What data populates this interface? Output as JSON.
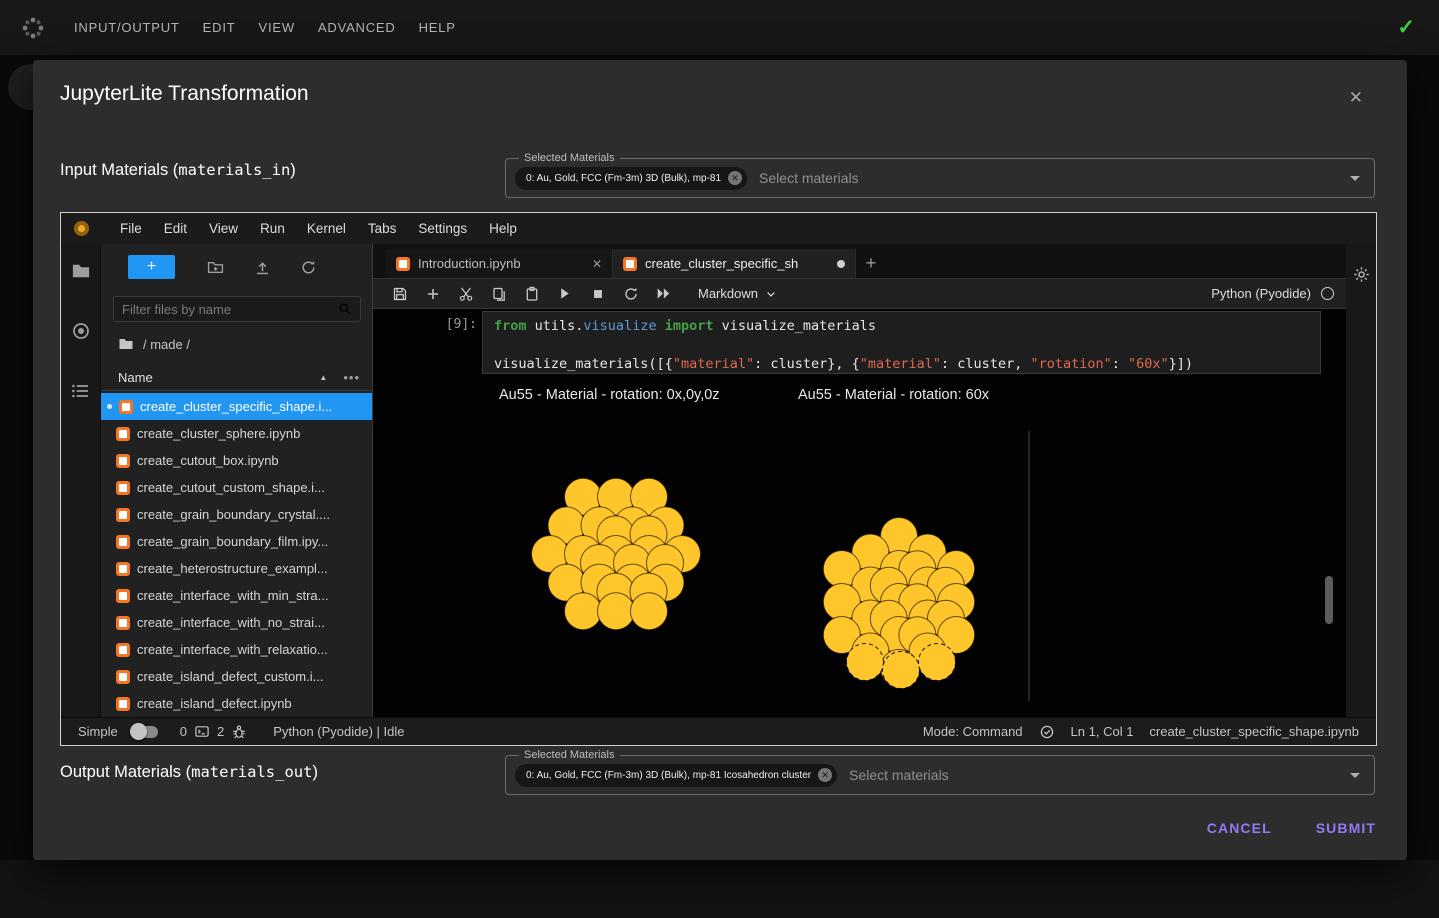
{
  "colors": {
    "accent_blue": "#2196F3",
    "jupyter_orange": "#F37726",
    "action_purple": "#9379F2",
    "success_green": "#3ECF4A",
    "atom_gold": "#FFC62B"
  },
  "topbar": {
    "menu": [
      "INPUT/OUTPUT",
      "EDIT",
      "VIEW",
      "ADVANCED",
      "HELP"
    ],
    "check_icon": "✓"
  },
  "dialog": {
    "title": "JupyterLite Transformation",
    "close_icon": "✕",
    "input": {
      "label_prefix": "Input Materials (",
      "label_code": "materials_in",
      "label_suffix": ")",
      "field_label": "Selected Materials",
      "chip_label": "0: Au, Gold, FCC (Fm-3m) 3D (Bulk), mp-81",
      "placeholder": "Select materials"
    },
    "output": {
      "label_prefix": "Output Materials (",
      "label_code": "materials_out",
      "label_suffix": ")",
      "field_label": "Selected Materials",
      "chip_label": "0: Au, Gold, FCC (Fm-3m) 3D (Bulk), mp-81 Icosahedron cluster",
      "placeholder": "Select materials"
    },
    "cancel_label": "CANCEL",
    "submit_label": "SUBMIT"
  },
  "jupyter": {
    "menu": [
      "File",
      "Edit",
      "View",
      "Run",
      "Kernel",
      "Tabs",
      "Settings",
      "Help"
    ],
    "filebrowser": {
      "filter_placeholder": "Filter files by name",
      "breadcrumb": "/ made /",
      "name_header": "Name",
      "files": [
        {
          "label": "create_cluster_specific_shape.i...",
          "selected": true
        },
        {
          "label": "create_cluster_sphere.ipynb",
          "selected": false
        },
        {
          "label": "create_cutout_box.ipynb",
          "selected": false
        },
        {
          "label": "create_cutout_custom_shape.i...",
          "selected": false
        },
        {
          "label": "create_grain_boundary_crystal....",
          "selected": false
        },
        {
          "label": "create_grain_boundary_film.ipy...",
          "selected": false
        },
        {
          "label": "create_heterostructure_exampl...",
          "selected": false
        },
        {
          "label": "create_interface_with_min_stra...",
          "selected": false
        },
        {
          "label": "create_interface_with_no_strai...",
          "selected": false
        },
        {
          "label": "create_interface_with_relaxatio...",
          "selected": false
        },
        {
          "label": "create_island_defect_custom.i...",
          "selected": false
        },
        {
          "label": "create_island_defect.ipynb",
          "selected": false
        }
      ]
    },
    "tabs": {
      "tab1": "Introduction.ipynb",
      "tab2": "create_cluster_specific_sh"
    },
    "notebook_toolbar": {
      "cell_type": "Markdown",
      "kernel_name": "Python (Pyodide)"
    },
    "cell": {
      "prompt": "[9]:",
      "lines": [
        [
          {
            "t": "kw",
            "v": "from "
          },
          {
            "t": "pl",
            "v": "utils."
          },
          {
            "t": "fn",
            "v": "visualize"
          },
          {
            "t": "pl",
            "v": " "
          },
          {
            "t": "kw",
            "v": "import "
          },
          {
            "t": "pl",
            "v": "visualize_materials"
          }
        ],
        [],
        [
          {
            "t": "pl",
            "v": "visualize_materials([{"
          },
          {
            "t": "str",
            "v": "\"material\""
          },
          {
            "t": "pl",
            "v": ": cluster}, {"
          },
          {
            "t": "str",
            "v": "\"material\""
          },
          {
            "t": "pl",
            "v": ": cluster, "
          },
          {
            "t": "str",
            "v": "\"rotation\""
          },
          {
            "t": "pl",
            "v": ": "
          },
          {
            "t": "str",
            "v": "\"60x\""
          },
          {
            "t": "pl",
            "v": "}])"
          }
        ]
      ]
    },
    "outputs": {
      "left_label": "Au55 - Material - rotation: 0x,0y,0z",
      "right_label": "Au55 - Material - rotation: 60x",
      "atom_color": "#FFC62B"
    },
    "statusbar": {
      "simple_label": "Simple",
      "terminals_count": "0",
      "kernels_count": "2",
      "kernel_status": "Python (Pyodide) | Idle",
      "mode": "Mode: Command",
      "cursor_position": "Ln 1, Col 1",
      "filename": "create_cluster_specific_shape.ipynb"
    }
  }
}
